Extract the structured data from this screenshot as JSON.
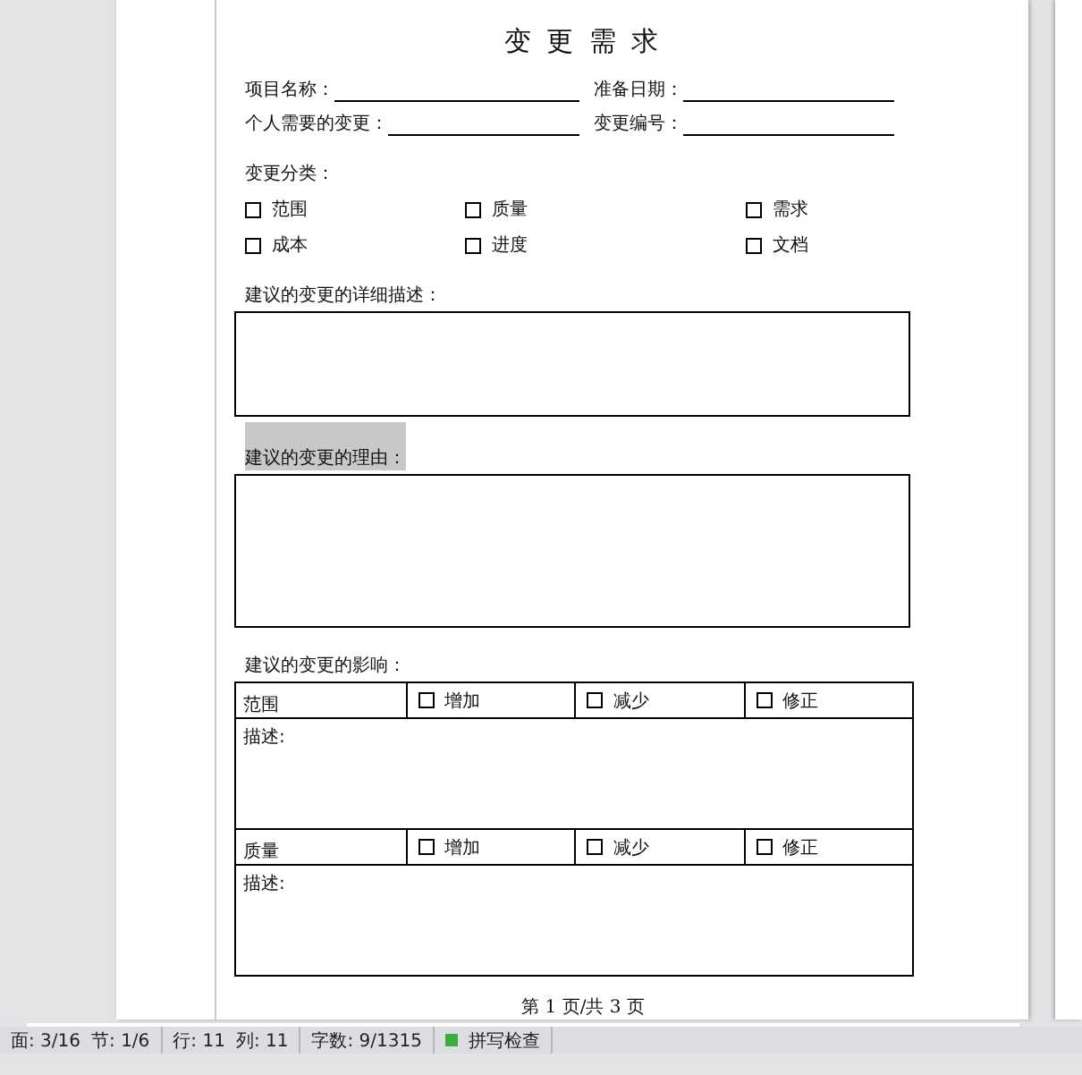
{
  "document": {
    "title": "变 更 需 求",
    "fields": [
      {
        "label": "项目名称："
      },
      {
        "label": "准备日期："
      },
      {
        "label": "个人需要的变更："
      },
      {
        "label": "变更编号："
      }
    ],
    "category_heading": "变更分类：",
    "categories": [
      {
        "label": "范围",
        "checked": false
      },
      {
        "label": "质量",
        "checked": false
      },
      {
        "label": "需求",
        "checked": false
      },
      {
        "label": "成本",
        "checked": false
      },
      {
        "label": "进度",
        "checked": false
      },
      {
        "label": "文档",
        "checked": false
      }
    ],
    "description_heading": "建议的变更的详细描述：",
    "reason_heading": {
      "text": "建议的变更的理由：",
      "highlighted": true
    },
    "impact_heading": "建议的变更的影响：",
    "impact_table": [
      {
        "area": "范围",
        "options": [
          {
            "label": "增加",
            "checked": false
          },
          {
            "label": "减少",
            "checked": false
          },
          {
            "label": "修正",
            "checked": false
          }
        ],
        "note": "描述:"
      },
      {
        "area": "质量",
        "options": [
          {
            "label": "增加",
            "checked": false
          },
          {
            "label": "减少",
            "checked": false
          },
          {
            "label": "修正",
            "checked": false
          }
        ],
        "note": "描述:"
      }
    ],
    "page_footer": "第 1 页/共 3 页"
  },
  "status_bar": {
    "sections": [
      [
        "面: 3/16",
        "节: 1/6"
      ],
      [
        "行: 11",
        "列: 11"
      ],
      [
        "字数: 9/1315"
      ]
    ],
    "spell_check": "拼写检查"
  }
}
